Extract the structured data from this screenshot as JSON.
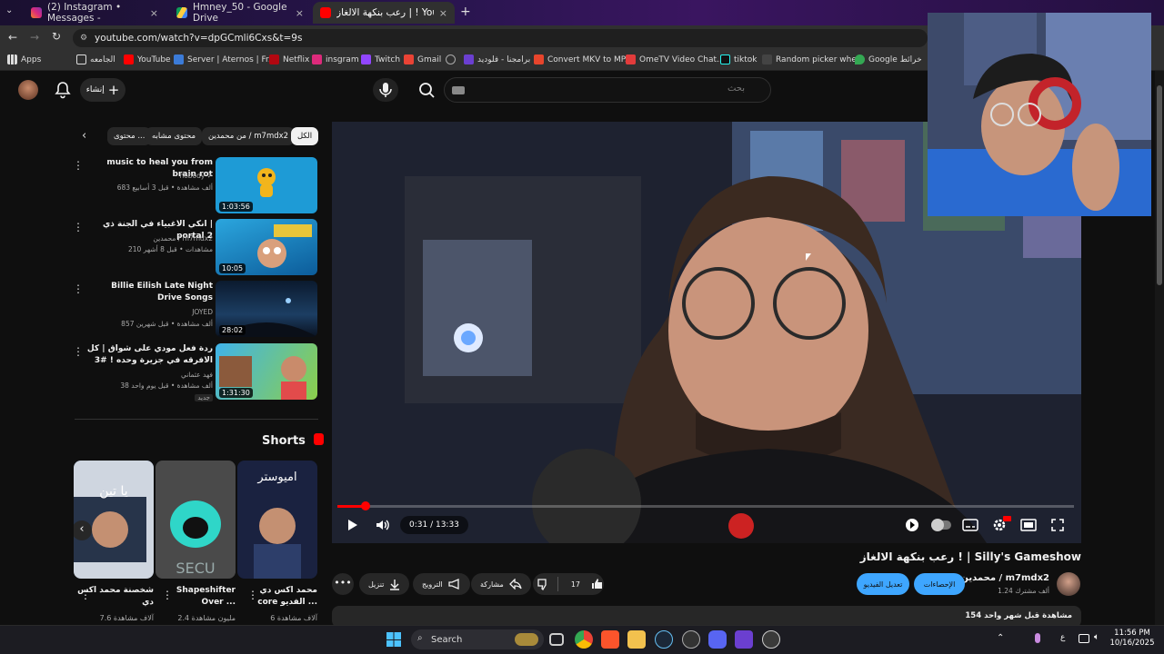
{
  "browser": {
    "tabs": [
      {
        "label": "(2) Instagram • Messages -",
        "close": "×"
      },
      {
        "label": "Hmney_50 - Google Drive",
        "close": "×"
      },
      {
        "label": "رعب بنكهة الالغاز | ! YouTube - ",
        "close": "×"
      }
    ],
    "new_tab": "+",
    "url": "youtube.com/watch?v=dpGCmli6Cxs&t=9s",
    "bookmarks": [
      "Apps",
      "الجامعه",
      "YouTube",
      "Server | Aternos | Fr...",
      "Netflix",
      "insgram",
      "Twitch",
      "Gmail",
      "برامجنا - فلوديد",
      "Convert MKV to MP...",
      "OmeTV Video Chat...",
      "tiktok",
      "Random picker whe...",
      "Google خرائط"
    ]
  },
  "header": {
    "search_placeholder": "بحث",
    "create_label": "إنشاء"
  },
  "chips": [
    "الكل",
    "من محمدين / m7mdx2",
    "محتوى مشابه",
    "محتوى ..."
  ],
  "recommendations": [
    {
      "title": "music to heal you from brain rot",
      "channel": "nobody ✓",
      "meta": "683 ألف مشاهدة • قبل 3 أسابيع",
      "duration": "1:03:56"
    },
    {
      "title": "انكي الاغبياء في الجنة ذي | portal 2",
      "channel": "محمدين / m7mdx2",
      "meta": "210 مشاهدات • قبل 8 أشهر",
      "duration": "10:05"
    },
    {
      "title": "Billie Eilish Late Night Drive Songs",
      "channel": "JOYED",
      "meta": "857 ألف مشاهدة • قبل شهرين",
      "duration": "28:02"
    },
    {
      "title": "ردة فعل مودي على شواق | كل الافرقه في جزيرة وحده ! #3",
      "channel": "فهد عثماني",
      "meta": "38 ألف مشاهدة • قبل يوم واحد",
      "badge": "جديد",
      "duration": "1:31:30"
    }
  ],
  "shorts": {
    "heading": "Shorts",
    "items": [
      {
        "caption": "محمد اكس دي core الفديو ...",
        "views": "6 آلاف مشاهدة"
      },
      {
        "caption": "Shapeshifter Over ...",
        "views": "2.4 مليون مشاهدة"
      },
      {
        "caption": "شخصنة محمد اكس دي",
        "views": "7.6 آلاف مشاهدة"
      }
    ]
  },
  "player": {
    "time": "0:31 / 13:33",
    "progress_fraction": 0.038
  },
  "video": {
    "title": "رعب بنكهة الالغاز ! | Silly's Gameshow",
    "channel": "محمدين / m7mdx2",
    "subscribers": "1.24 ألف مشترك",
    "stats_button": "الإحصاءات",
    "edit_button": "تعديل الفيديو",
    "likes": "17",
    "share": "مشاركة",
    "promote": "الترويج",
    "download": "تنزيل",
    "description_meta": "154 مشاهدة قبل شهر واحد"
  },
  "taskbar": {
    "search": "Search",
    "time": "11:56 PM",
    "date": "10/16/2025"
  },
  "colors": {
    "accent_red": "#ff0000",
    "accent_blue": "#3ea6ff",
    "bg": "#0f0f0f"
  }
}
